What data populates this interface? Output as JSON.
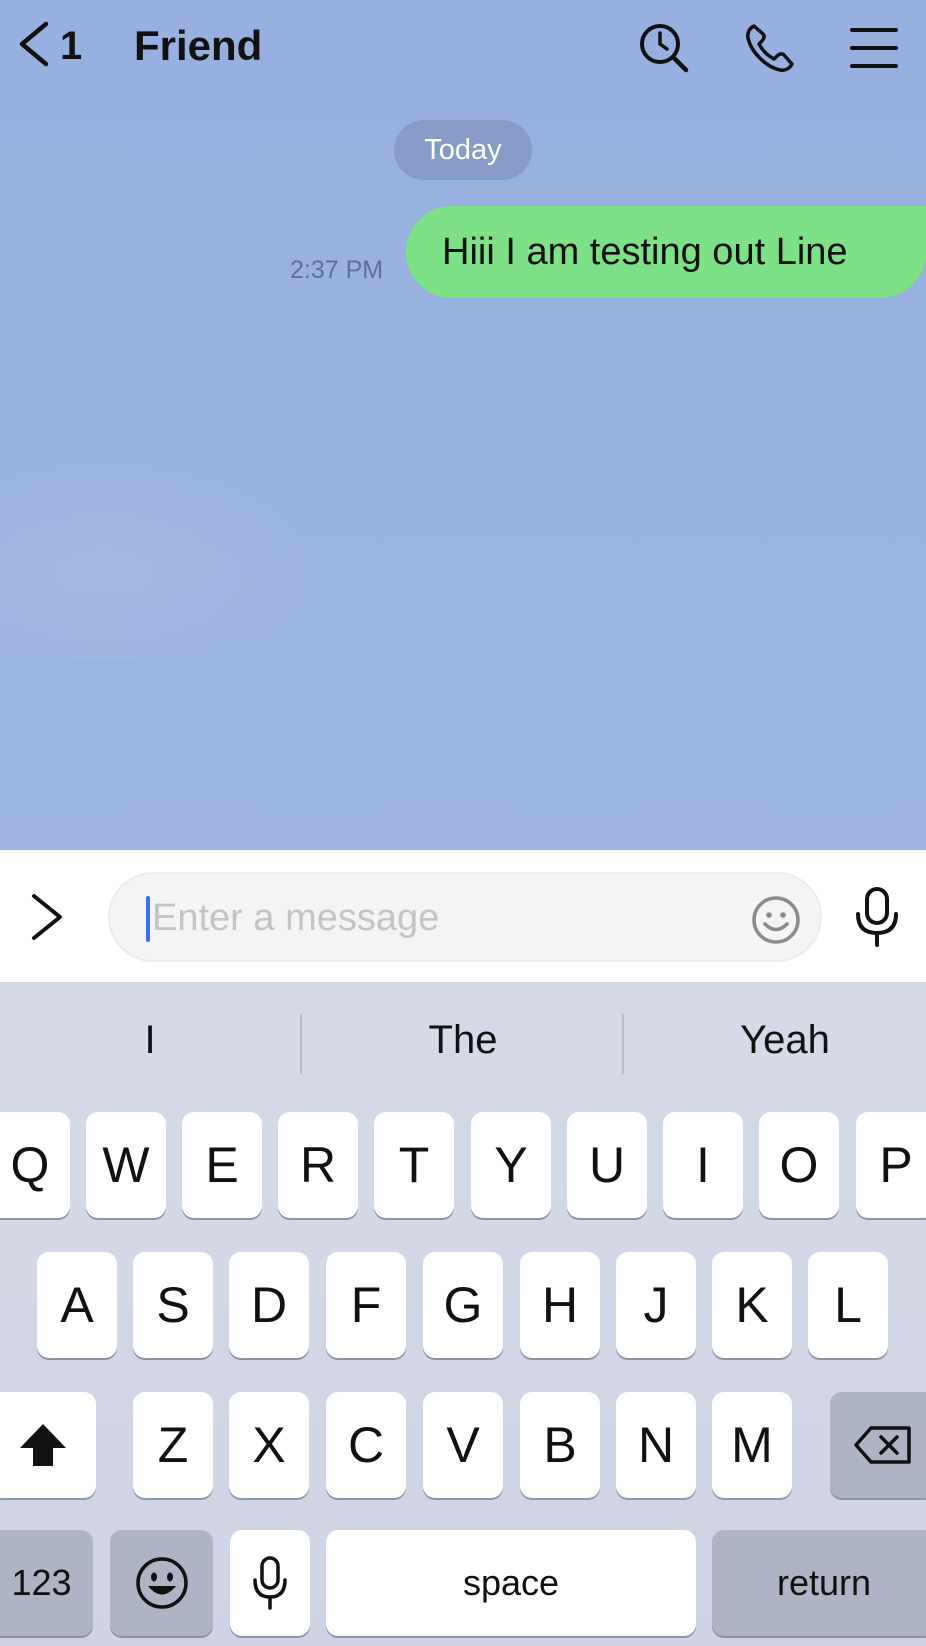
{
  "header": {
    "unread_count": "1",
    "title": "Friend",
    "icons": [
      "back-chevron-icon",
      "search-icon",
      "phone-icon",
      "menu-icon"
    ]
  },
  "chat": {
    "date_label": "Today",
    "messages": [
      {
        "text": "Hiii I am testing out Line",
        "time": "2:37 PM",
        "sender": "me"
      }
    ]
  },
  "input": {
    "placeholder": "Enter a message"
  },
  "keyboard": {
    "suggestions": [
      "I",
      "The",
      "Yeah"
    ],
    "row1": [
      "Q",
      "W",
      "E",
      "R",
      "T",
      "Y",
      "U",
      "I",
      "O",
      "P"
    ],
    "row2": [
      "A",
      "S",
      "D",
      "F",
      "G",
      "H",
      "J",
      "K",
      "L"
    ],
    "row3": [
      "Z",
      "X",
      "C",
      "V",
      "B",
      "N",
      "M"
    ],
    "numbers_label": "123",
    "space_label": "space",
    "return_label": "return"
  },
  "colors": {
    "chat_background": "#9ab2df",
    "bubble_me": "#7ee087",
    "caret": "#3a6ef5"
  }
}
